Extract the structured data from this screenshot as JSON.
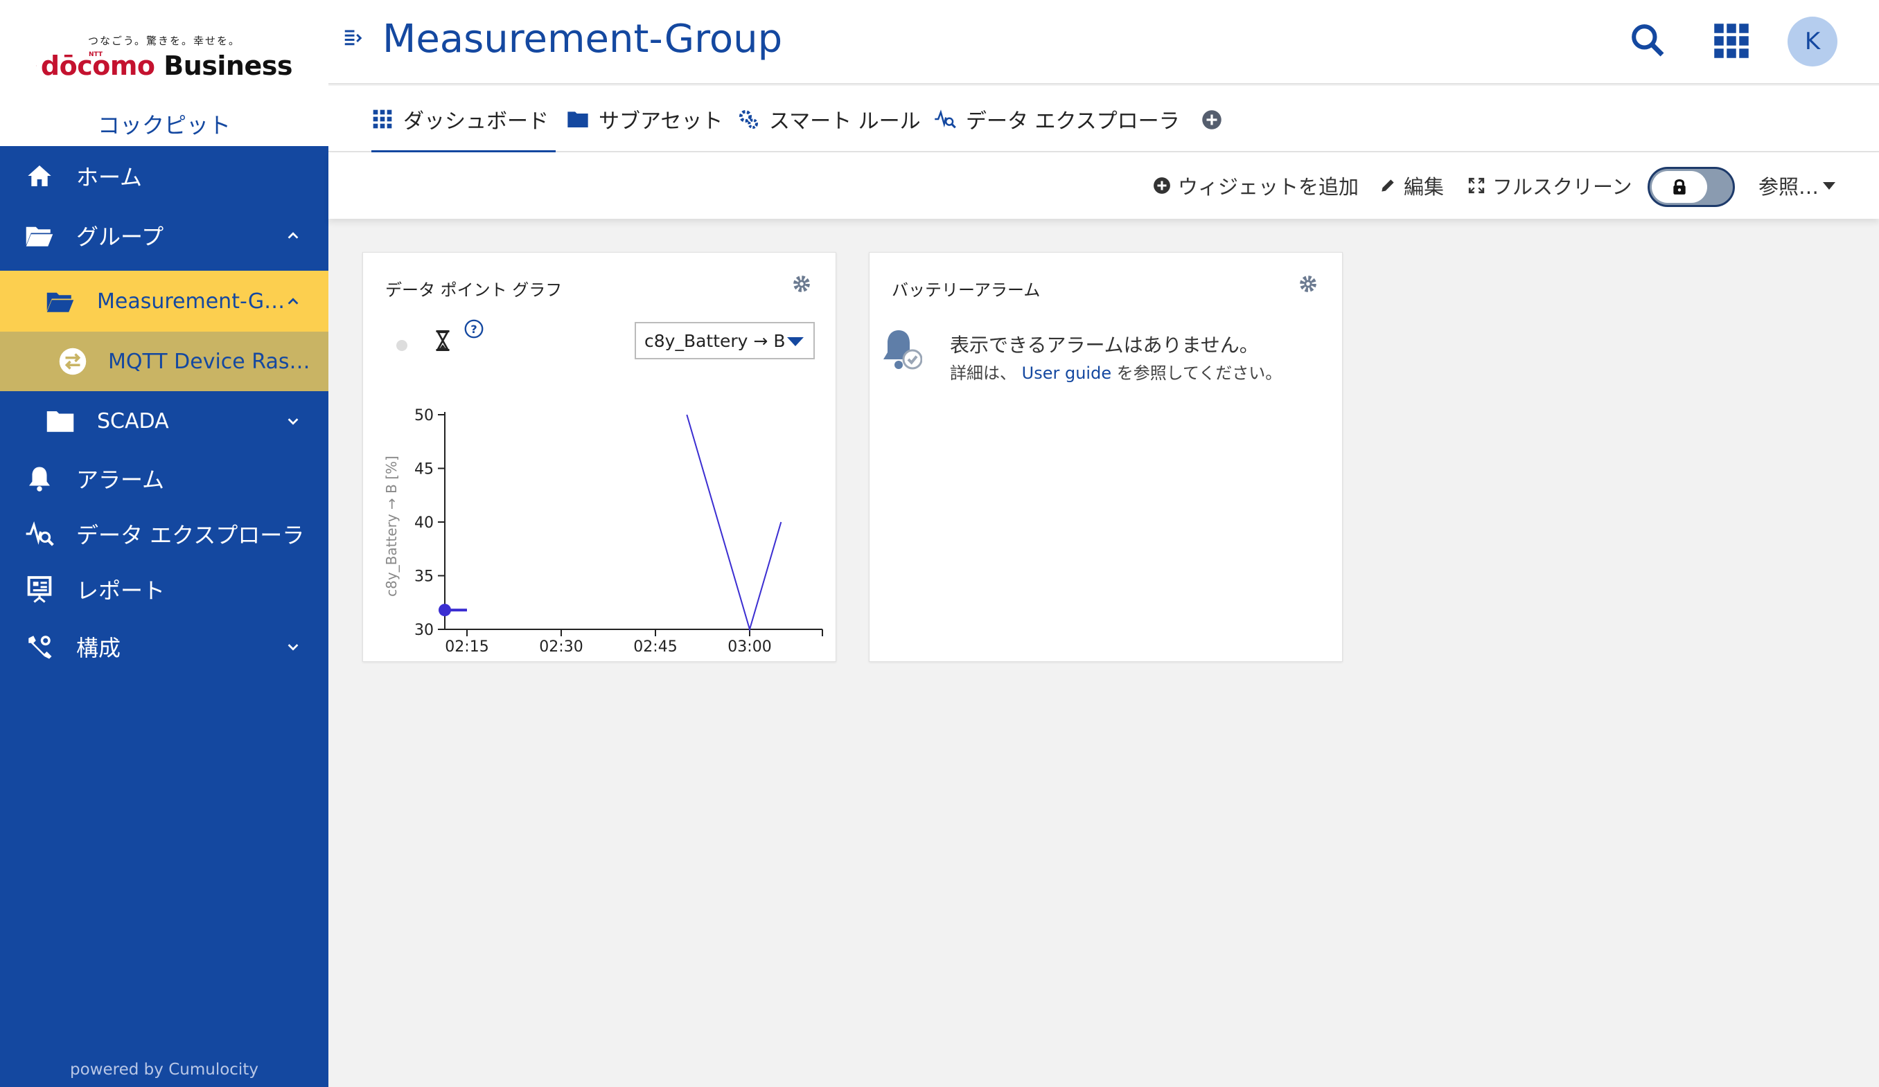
{
  "brand": {
    "tagline": "つなごう。驚きを。幸せを。",
    "ntt": "NTT",
    "name_red": "dōcomo",
    "name_black": " Business",
    "app_title": "コックピット"
  },
  "sidebar": {
    "items": [
      {
        "label": "ホーム",
        "icon": "home-icon"
      },
      {
        "label": "グループ",
        "icon": "folder-open-icon"
      },
      {
        "label": "Measurement-G…",
        "icon": "folder-open-icon"
      },
      {
        "label": "MQTT Device Ras…",
        "icon": "device-exchange-icon"
      },
      {
        "label": "SCADA",
        "icon": "folder-icon"
      },
      {
        "label": "アラーム",
        "icon": "bell-icon"
      },
      {
        "label": "データ エクスプローラ",
        "icon": "data-explorer-icon"
      },
      {
        "label": "レポート",
        "icon": "report-icon"
      },
      {
        "label": "構成",
        "icon": "wrench-icon"
      }
    ],
    "powered_by": "powered by Cumulocity"
  },
  "header": {
    "title": "Measurement-Group",
    "avatar_initial": "K"
  },
  "tabs": [
    {
      "label": "ダッシュボード",
      "icon": "grid-icon",
      "active": true
    },
    {
      "label": "サブアセット",
      "icon": "folder-icon",
      "active": false
    },
    {
      "label": "スマート ルール",
      "icon": "gears-icon",
      "active": false
    },
    {
      "label": "データ エクスプローラ",
      "icon": "data-explorer-icon",
      "active": false
    }
  ],
  "actions": {
    "add_widget": "ウィジェットを追加",
    "edit": "編集",
    "fullscreen": "フルスクリーン",
    "more": "参照…"
  },
  "widgets": {
    "graph": {
      "title": "データ ポイント グラフ",
      "select_value": "c8y_Battery → B",
      "chart_data": {
        "type": "line",
        "ylabel": "c8y_Battery → B [%]",
        "ylim": [
          30,
          50
        ],
        "y_ticks": [
          "50",
          "45",
          "40",
          "35",
          "30"
        ],
        "x_ticks": [
          "02:15",
          "02:30",
          "02:45",
          "03:00"
        ],
        "series": [
          {
            "color": "#3b2ed1",
            "points": [
              {
                "t": "02:07",
                "y": 31.8
              },
              {
                "t": "02:07",
                "y": 31.8
              },
              {
                "t": "02:15",
                "y": 31.8
              }
            ]
          },
          {
            "color": "#3b2ed1",
            "points": [
              {
                "t": "02:50",
                "y": 50
              },
              {
                "t": "03:00",
                "y": 30
              },
              {
                "t": "03:05",
                "y": 40
              }
            ]
          }
        ]
      }
    },
    "alarm": {
      "title": "バッテリーアラーム",
      "message": "表示できるアラームはありません。",
      "detail_prefix": "詳細は、 ",
      "detail_link": "User guide",
      "detail_suffix": " を参照してください。"
    }
  }
}
